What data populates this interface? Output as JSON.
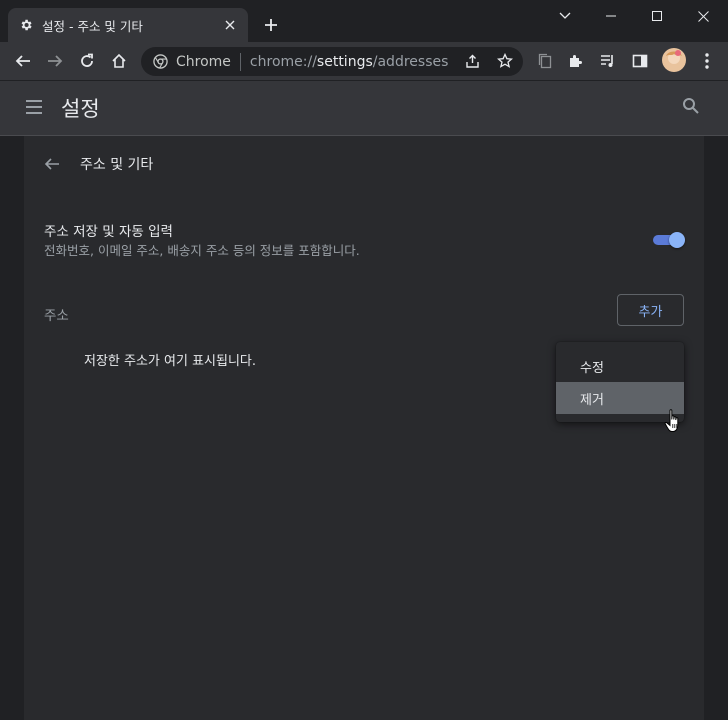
{
  "browser": {
    "tab_title": "설정 - 주소 및 기타",
    "omnibox_site": "Chrome",
    "url_scheme": "chrome://",
    "url_host": "settings",
    "url_path": "/addresses"
  },
  "header": {
    "title": "설정"
  },
  "page": {
    "subpage_title": "주소 및 기타",
    "autofill_title": "주소 저장 및 자동 입력",
    "autofill_desc": "전화번호, 이메일 주소, 배송지 주소 등의 정보를 포함합니다.",
    "autofill_enabled": true,
    "section_label": "주소",
    "add_label": "추가",
    "empty_message": "저장한 주소가 여기 표시됩니다."
  },
  "context_menu": {
    "items": [
      {
        "label": "수정",
        "hovered": false
      },
      {
        "label": "제거",
        "hovered": true
      }
    ]
  },
  "colors": {
    "accent": "#8ab4f8",
    "toggle_track": "#5b7bd8",
    "background": "#202124",
    "surface": "#292a2d"
  }
}
